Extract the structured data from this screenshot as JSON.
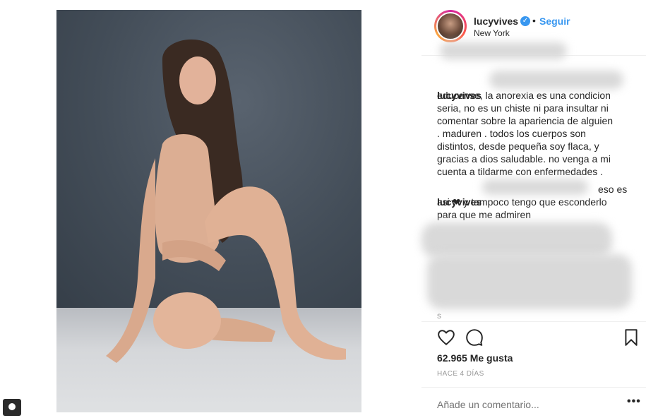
{
  "post": {
    "likes_text": "62.965 Me gusta",
    "time_text": "HACE 4 DÍAS",
    "add_comment_placeholder": "Añade un comentario...",
    "more_label": "•••"
  },
  "header": {
    "username": "lucyvives",
    "verified_mark": "✓",
    "dot": "•",
    "follow_label": "Seguir",
    "location": "New York"
  },
  "comments": [
    {
      "user": "lucyvives",
      "text": "educense, la anorexia es una condicion\nseria, no es un chiste ni para insultar ni\ncomentar sobre la apariencia de alguien\n. maduren . todos los cuerpos son\ndistintos, desde pequeña soy flaca, y\ngracias a dios saludable. no venga a mi\ncuenta a tildarme con enfermedades ."
    },
    {
      "user": "lucyvives",
      "lead": "eso es",
      "text": "asi ❤ y tampoco tengo que esconderlo\npara que me admiren"
    }
  ],
  "fragments": {
    "s_letter": "s"
  },
  "icons": {
    "like": "heart-icon",
    "comment": "comment-icon",
    "save": "bookmark-icon"
  },
  "colors": {
    "accent": "#3897f0",
    "text": "#262626",
    "muted": "#999999",
    "border": "#efefef"
  }
}
